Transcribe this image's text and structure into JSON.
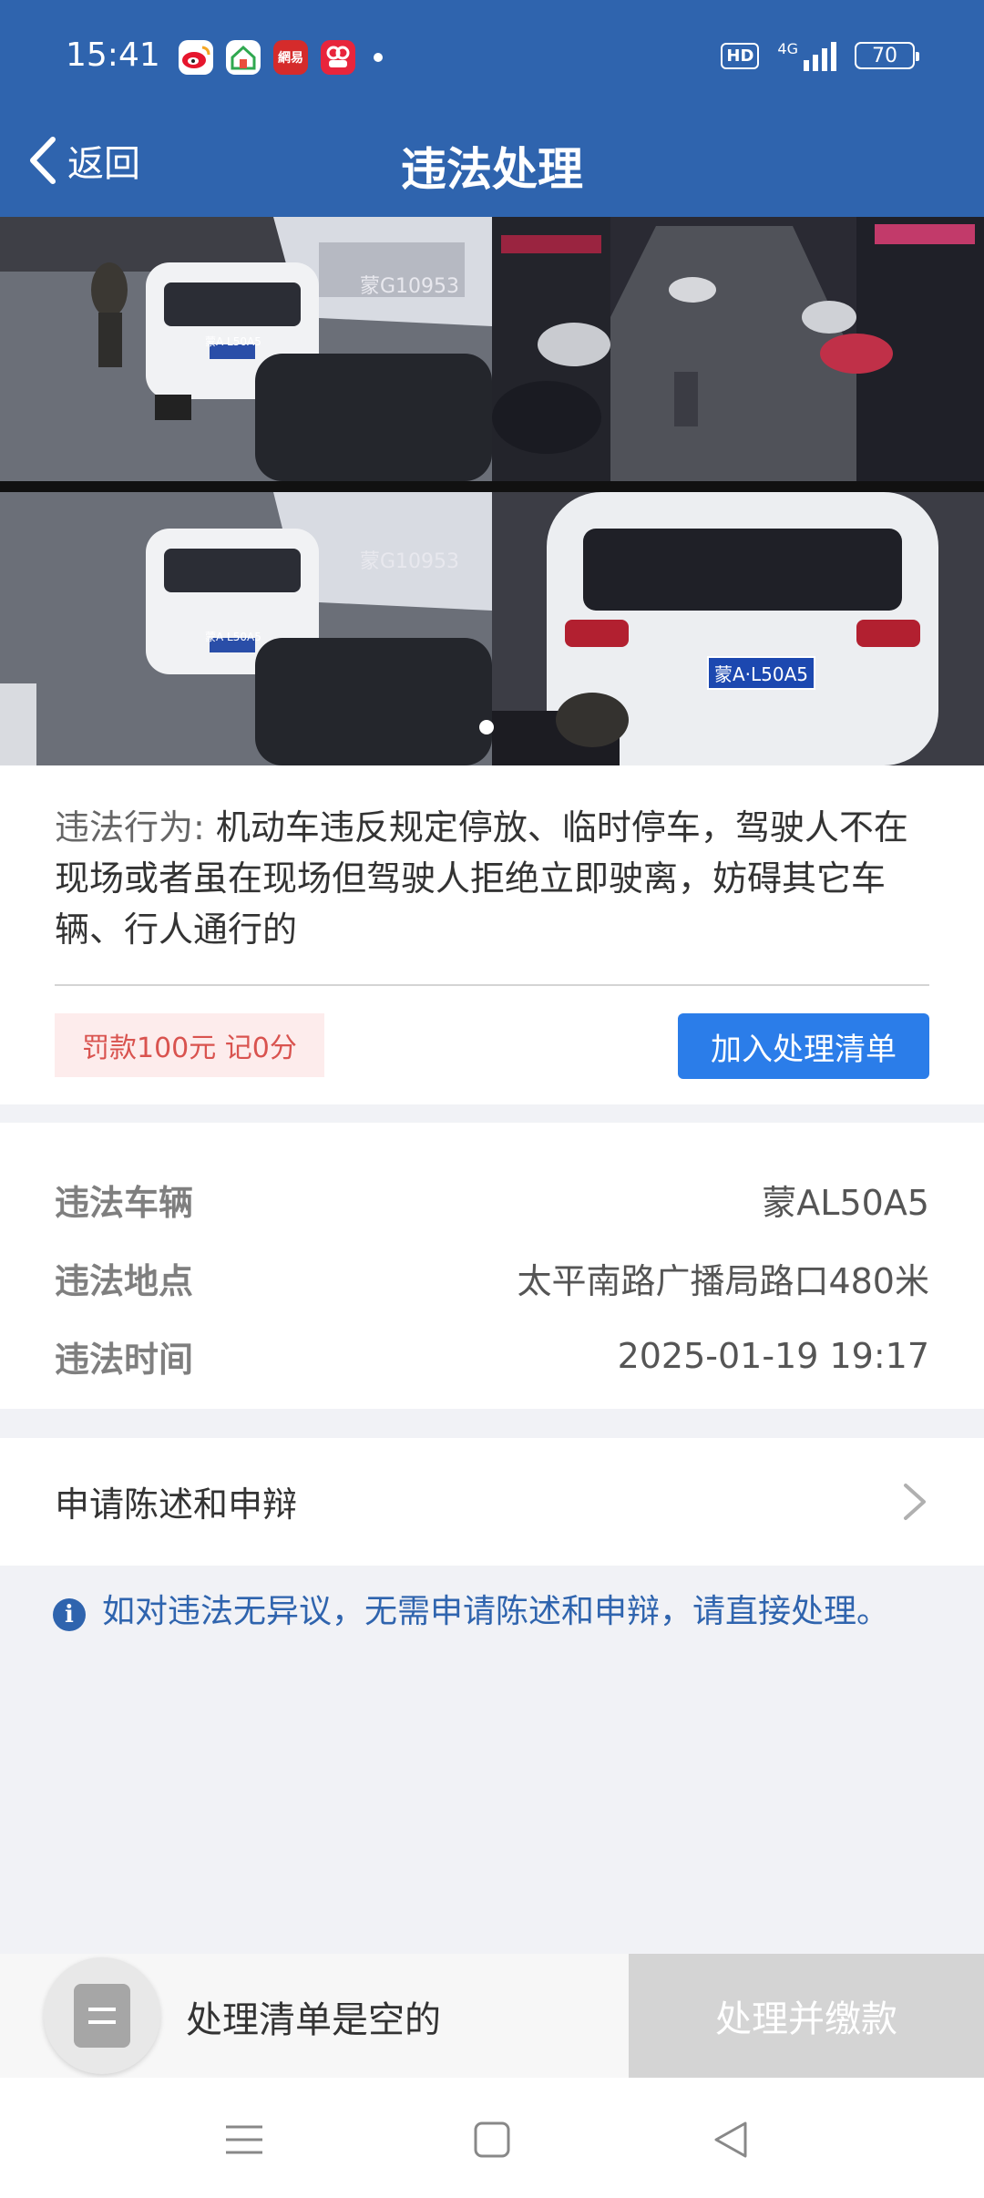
{
  "status_bar": {
    "time": "15:41",
    "apps": [
      {
        "name": "weibo-icon",
        "color": "#f5a623"
      },
      {
        "name": "home-app-icon",
        "color": "#e94e3b"
      },
      {
        "name": "netease-icon",
        "color": "#d52b2b",
        "label": "網易"
      },
      {
        "name": "video-app-icon",
        "color": "#e8253c"
      }
    ],
    "hd": "HD",
    "network": "4G",
    "battery": "70"
  },
  "header": {
    "back_label": "返回",
    "title": "违法处理"
  },
  "photos": {
    "plate_top": "蒙G10953",
    "plate_small": "蒙A L50A5",
    "plate_large": "蒙A·L50A5"
  },
  "violation": {
    "label": "违法行为:",
    "description": "机动车违反规定停放、临时停车，驾驶人不在现场或者虽在现场但驾驶人拒绝立即驶离，妨碍其它车辆、行人通行的",
    "fine": "罚款100元 记0分",
    "add_button": "加入处理清单"
  },
  "details": [
    {
      "key": "违法车辆",
      "value": "蒙AL50A5"
    },
    {
      "key": "违法地点",
      "value": "太平南路广播局路口480米"
    },
    {
      "key": "违法时间",
      "value": "2025-01-19 19:17"
    }
  ],
  "appeal": {
    "label": "申请陈述和申辩"
  },
  "info": {
    "icon": "i",
    "text": "如对违法无异议，无需申请陈述和申辩，请直接处理。"
  },
  "bottom": {
    "empty_text": "处理清单是空的",
    "pay_button": "处理并缴款"
  },
  "colors": {
    "brand": "#2f64ae",
    "button": "#2b7de9",
    "fine_text": "#d9534f",
    "fine_bg": "#fdecec",
    "disabled": "#d4d4d4"
  }
}
